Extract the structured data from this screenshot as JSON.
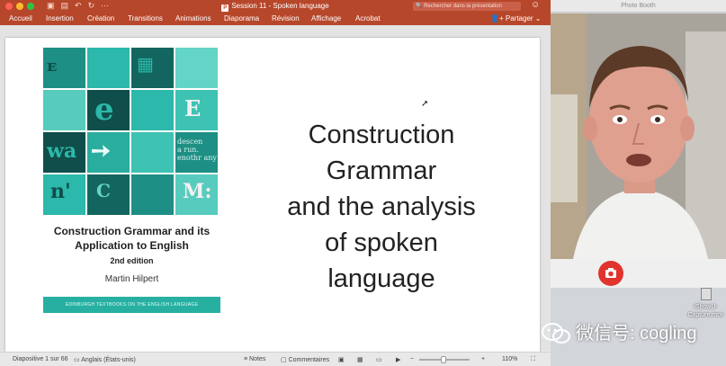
{
  "ppt": {
    "window_title": "Session 11 - Spoken language",
    "ribbon_tabs": [
      "Accueil",
      "Insertion",
      "Création",
      "Transitions",
      "Animations",
      "Diaporama",
      "Révision",
      "Affichage",
      "Acrobat"
    ],
    "search_placeholder": "Rechercher dans la présentation",
    "share_label": "Partager",
    "slide": {
      "book_title": "Construction Grammar and its Application to English",
      "book_edition": "2nd edition",
      "book_author": "Martin Hilpert",
      "book_series": "EDINBURGH TEXTBOOKS ON THE ENGLISH LANGUAGE",
      "title_lines": [
        "Construction",
        "Grammar",
        "and the analysis",
        "of spoken",
        "language"
      ]
    },
    "status": {
      "slide_info": "Diapositive 1 sur 66",
      "language": "Anglais (États-unis)",
      "notes": "Notes",
      "comments": "Commentaires",
      "zoom_minus": "−",
      "zoom_plus": "+",
      "zoom": "110%"
    }
  },
  "photobooth": {
    "title": "Photo Booth"
  },
  "desktop_file": {
    "name_line1": "iShowU-",
    "name_line2": "Capture.mov"
  },
  "watermark": "微信号: cogling",
  "colors": {
    "ppt_accent": "#b7472a",
    "cover_teal": "#27b0a2",
    "shutter_red": "#e0342d"
  }
}
